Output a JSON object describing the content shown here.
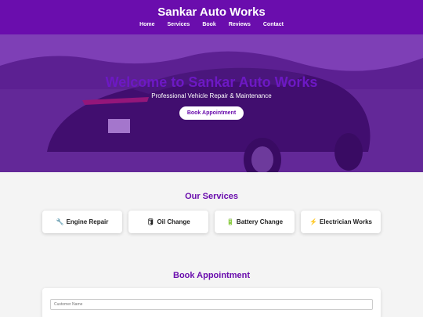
{
  "header": {
    "title": "Sankar Auto Works",
    "nav": [
      "Home",
      "Services",
      "Book",
      "Reviews",
      "Contact"
    ]
  },
  "hero": {
    "heading": "Welcome to Sankar Auto Works",
    "subtitle": "Professional Vehicle Repair & Maintenance",
    "button_label": "Book Appointment"
  },
  "services": {
    "title": "Our Services",
    "items": [
      {
        "icon": "wrench-icon",
        "label": "Engine Repair"
      },
      {
        "icon": "oil-icon",
        "label": "Oil Change"
      },
      {
        "icon": "battery-icon",
        "label": "Battery Change"
      },
      {
        "icon": "lightning-icon",
        "label": "Electrician Works"
      }
    ]
  },
  "booking": {
    "title": "Book Appointment",
    "name_placeholder": "Customer Name"
  },
  "colors": {
    "brand": "#6a0dad",
    "background": "#f4f4f4"
  }
}
